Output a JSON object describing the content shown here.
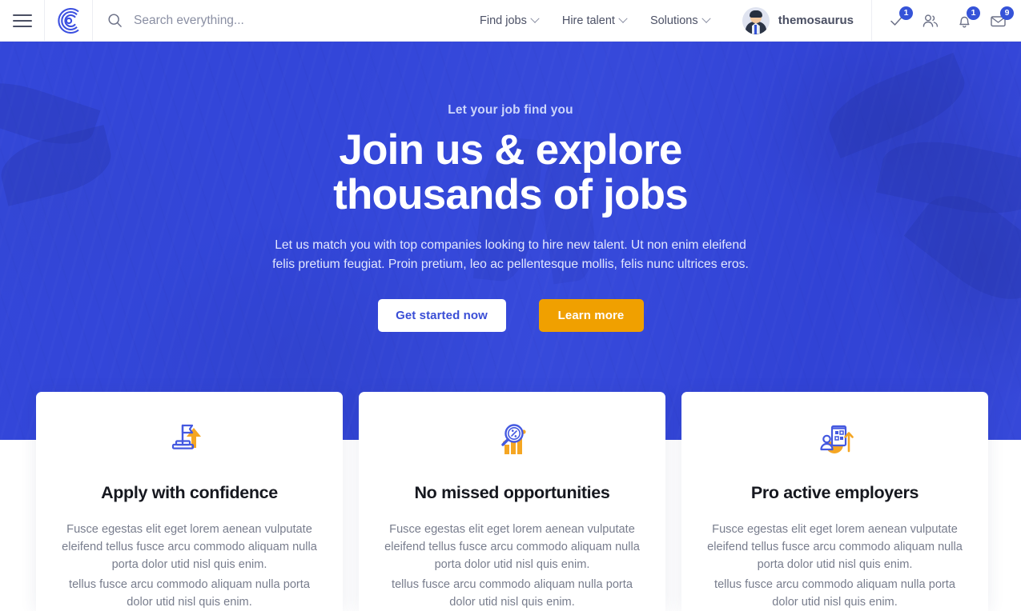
{
  "header": {
    "menu_icon": "hamburger-menu-icon",
    "logo_icon": "brand-logo-icon",
    "search": {
      "icon": "search-icon",
      "placeholder": "Search everything...",
      "value": ""
    },
    "nav": [
      {
        "label": "Find jobs",
        "caret": "chevron-down-icon"
      },
      {
        "label": "Hire talent",
        "caret": "chevron-down-icon"
      },
      {
        "label": "Solutions",
        "caret": "chevron-down-icon"
      }
    ],
    "user": {
      "name": "themosaurus",
      "avatar": "user-avatar"
    },
    "icons": [
      {
        "name": "tasks-check-icon",
        "glyph": "check",
        "badge": "1"
      },
      {
        "name": "contacts-people-icon",
        "glyph": "people",
        "badge": ""
      },
      {
        "name": "notifications-bell-icon",
        "glyph": "bell",
        "badge": "1"
      },
      {
        "name": "messages-envelope-icon",
        "glyph": "envelope",
        "badge": "9"
      }
    ]
  },
  "hero": {
    "eyebrow": "Let your job find you",
    "title_line1": "Join us & explore",
    "title_line2": "thousands of jobs",
    "subtitle": "Let us match you with top companies looking to hire new talent. Ut non enim eleifend felis pretium feugiat. Proin pretium, leo ac pellentesque mollis, felis nunc ultrices eros.",
    "primary_button": "Get started now",
    "secondary_button": "Learn more"
  },
  "cards": [
    {
      "icon": "flag-arrow-up-icon",
      "title": "Apply with confidence",
      "text1": "Fusce egestas elit eget lorem aenean vulputate eleifend tellus fusce arcu commodo aliquam nulla porta dolor utid nisl quis enim.",
      "text2": "tellus fusce arcu commodo aliquam nulla porta dolor utid nisl quis enim."
    },
    {
      "icon": "magnifier-bar-chart-icon",
      "title": "No missed opportunities",
      "text1": "Fusce egestas elit eget lorem aenean vulputate eleifend tellus fusce arcu commodo aliquam nulla porta dolor utid nisl quis enim.",
      "text2": "tellus fusce arcu commodo aliquam nulla porta dolor utid nisl quis enim."
    },
    {
      "icon": "person-document-arrow-up-icon",
      "title": "Pro active employers",
      "text1": "Fusce egestas elit eget lorem aenean vulputate eleifend tellus fusce arcu commodo aliquam nulla porta dolor utid nisl quis enim.",
      "text2": "tellus fusce arcu commodo aliquam nulla porta dolor utid nisl quis enim."
    }
  ],
  "colors": {
    "brand_blue": "#3553d8",
    "hero_blue": "#3145d4",
    "accent_orange": "#f0a000",
    "icon_blue": "#4459e0",
    "text_dark": "#16181f",
    "text_muted": "#787d8d"
  }
}
